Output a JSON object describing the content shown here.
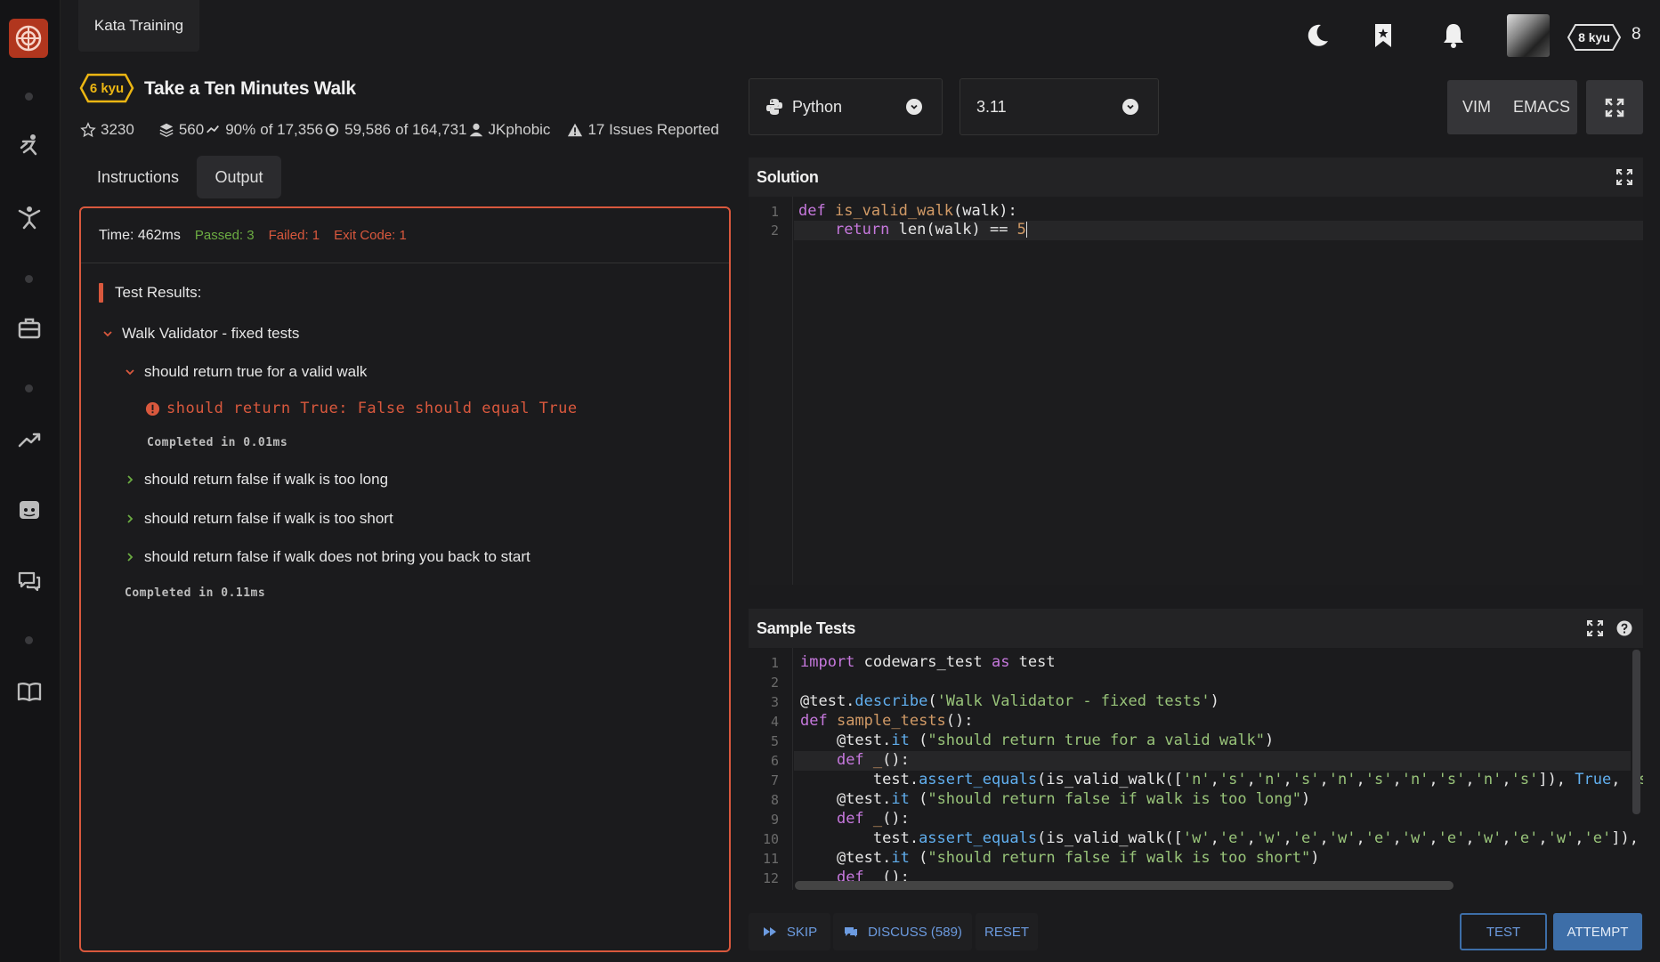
{
  "rail": {
    "icons": [
      "codewars-logo-icon",
      "kata-training-icon",
      "practice-icon",
      "briefcase-icon",
      "leaderboard-icon",
      "discord-icon",
      "discussions-icon",
      "docs-icon"
    ]
  },
  "header": {
    "tab_label": "Kata Training",
    "rank_badge": "8 kyu",
    "honor": "8"
  },
  "kata": {
    "kyu": "6 kyu",
    "title": "Take a Ten Minutes Walk",
    "stars": "3230",
    "collections": "560",
    "satisfaction_pct": "90%",
    "satisfaction_of": "of 17,356",
    "completed": "59,586",
    "completed_of": "of 164,731",
    "author": "JKphobic",
    "issues": "17 Issues Reported"
  },
  "tabs": {
    "instructions": "Instructions",
    "output": "Output"
  },
  "output": {
    "time": "Time: 462ms",
    "passed": "Passed: 3",
    "failed": "Failed: 1",
    "exit_code": "Exit Code: 1",
    "results_title": "Test Results:",
    "group": "Walk Validator - fixed tests",
    "tests": [
      {
        "label": "should return true for a valid walk"
      },
      {
        "label": "should return false if walk is too long"
      },
      {
        "label": "should return false if walk is too short"
      },
      {
        "label": "should return false if walk does not bring you back to start"
      }
    ],
    "fail_message": "should return True: False should equal True",
    "inner_completed": "Completed in 0.01ms",
    "group_completed": "Completed in 0.11ms"
  },
  "editor": {
    "language": "Python",
    "version": "3.11",
    "vim_label": "VIM",
    "emacs_label": "EMACS",
    "solution_title": "Solution",
    "sample_title": "Sample Tests",
    "solution_lines": [
      "1",
      "2"
    ],
    "sample_line_numbers": [
      "1",
      "2",
      "3",
      "4",
      "5",
      "6",
      "7",
      "8",
      "9",
      "10",
      "11",
      "12"
    ]
  },
  "actions": {
    "skip": "SKIP",
    "discuss": "DISCUSS (589)",
    "reset": "RESET",
    "test": "TEST",
    "attempt": "ATTEMPT"
  },
  "colors": {
    "accent_red": "#d9583d",
    "kyu_yellow": "#ecb613",
    "passed_green": "#6cac42",
    "action_blue": "#3d6ea8"
  }
}
